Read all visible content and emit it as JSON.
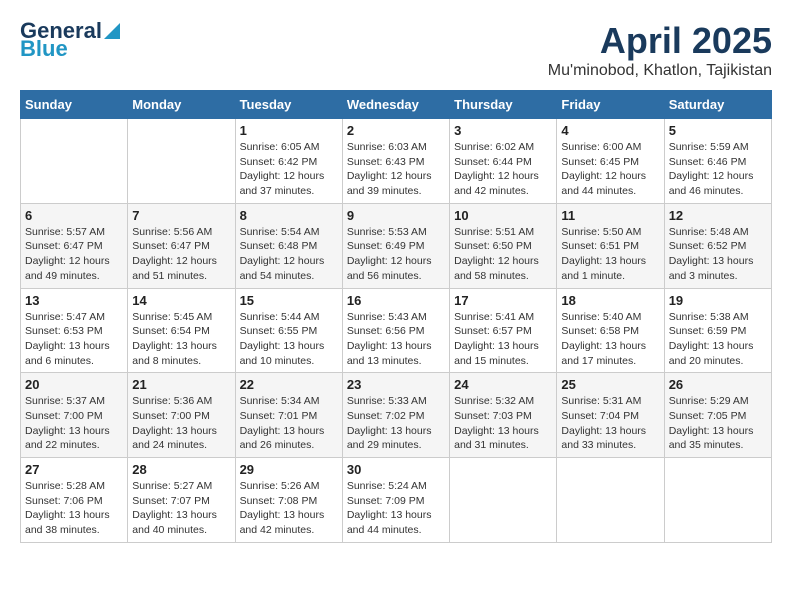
{
  "logo": {
    "line1": "General",
    "line2": "Blue"
  },
  "title": "April 2025",
  "subtitle": "Mu'minobod, Khatlon, Tajikistan",
  "days_of_week": [
    "Sunday",
    "Monday",
    "Tuesday",
    "Wednesday",
    "Thursday",
    "Friday",
    "Saturday"
  ],
  "weeks": [
    [
      {
        "day": "",
        "detail": ""
      },
      {
        "day": "",
        "detail": ""
      },
      {
        "day": "1",
        "detail": "Sunrise: 6:05 AM\nSunset: 6:42 PM\nDaylight: 12 hours and 37 minutes."
      },
      {
        "day": "2",
        "detail": "Sunrise: 6:03 AM\nSunset: 6:43 PM\nDaylight: 12 hours and 39 minutes."
      },
      {
        "day": "3",
        "detail": "Sunrise: 6:02 AM\nSunset: 6:44 PM\nDaylight: 12 hours and 42 minutes."
      },
      {
        "day": "4",
        "detail": "Sunrise: 6:00 AM\nSunset: 6:45 PM\nDaylight: 12 hours and 44 minutes."
      },
      {
        "day": "5",
        "detail": "Sunrise: 5:59 AM\nSunset: 6:46 PM\nDaylight: 12 hours and 46 minutes."
      }
    ],
    [
      {
        "day": "6",
        "detail": "Sunrise: 5:57 AM\nSunset: 6:47 PM\nDaylight: 12 hours and 49 minutes."
      },
      {
        "day": "7",
        "detail": "Sunrise: 5:56 AM\nSunset: 6:47 PM\nDaylight: 12 hours and 51 minutes."
      },
      {
        "day": "8",
        "detail": "Sunrise: 5:54 AM\nSunset: 6:48 PM\nDaylight: 12 hours and 54 minutes."
      },
      {
        "day": "9",
        "detail": "Sunrise: 5:53 AM\nSunset: 6:49 PM\nDaylight: 12 hours and 56 minutes."
      },
      {
        "day": "10",
        "detail": "Sunrise: 5:51 AM\nSunset: 6:50 PM\nDaylight: 12 hours and 58 minutes."
      },
      {
        "day": "11",
        "detail": "Sunrise: 5:50 AM\nSunset: 6:51 PM\nDaylight: 13 hours and 1 minute."
      },
      {
        "day": "12",
        "detail": "Sunrise: 5:48 AM\nSunset: 6:52 PM\nDaylight: 13 hours and 3 minutes."
      }
    ],
    [
      {
        "day": "13",
        "detail": "Sunrise: 5:47 AM\nSunset: 6:53 PM\nDaylight: 13 hours and 6 minutes."
      },
      {
        "day": "14",
        "detail": "Sunrise: 5:45 AM\nSunset: 6:54 PM\nDaylight: 13 hours and 8 minutes."
      },
      {
        "day": "15",
        "detail": "Sunrise: 5:44 AM\nSunset: 6:55 PM\nDaylight: 13 hours and 10 minutes."
      },
      {
        "day": "16",
        "detail": "Sunrise: 5:43 AM\nSunset: 6:56 PM\nDaylight: 13 hours and 13 minutes."
      },
      {
        "day": "17",
        "detail": "Sunrise: 5:41 AM\nSunset: 6:57 PM\nDaylight: 13 hours and 15 minutes."
      },
      {
        "day": "18",
        "detail": "Sunrise: 5:40 AM\nSunset: 6:58 PM\nDaylight: 13 hours and 17 minutes."
      },
      {
        "day": "19",
        "detail": "Sunrise: 5:38 AM\nSunset: 6:59 PM\nDaylight: 13 hours and 20 minutes."
      }
    ],
    [
      {
        "day": "20",
        "detail": "Sunrise: 5:37 AM\nSunset: 7:00 PM\nDaylight: 13 hours and 22 minutes."
      },
      {
        "day": "21",
        "detail": "Sunrise: 5:36 AM\nSunset: 7:00 PM\nDaylight: 13 hours and 24 minutes."
      },
      {
        "day": "22",
        "detail": "Sunrise: 5:34 AM\nSunset: 7:01 PM\nDaylight: 13 hours and 26 minutes."
      },
      {
        "day": "23",
        "detail": "Sunrise: 5:33 AM\nSunset: 7:02 PM\nDaylight: 13 hours and 29 minutes."
      },
      {
        "day": "24",
        "detail": "Sunrise: 5:32 AM\nSunset: 7:03 PM\nDaylight: 13 hours and 31 minutes."
      },
      {
        "day": "25",
        "detail": "Sunrise: 5:31 AM\nSunset: 7:04 PM\nDaylight: 13 hours and 33 minutes."
      },
      {
        "day": "26",
        "detail": "Sunrise: 5:29 AM\nSunset: 7:05 PM\nDaylight: 13 hours and 35 minutes."
      }
    ],
    [
      {
        "day": "27",
        "detail": "Sunrise: 5:28 AM\nSunset: 7:06 PM\nDaylight: 13 hours and 38 minutes."
      },
      {
        "day": "28",
        "detail": "Sunrise: 5:27 AM\nSunset: 7:07 PM\nDaylight: 13 hours and 40 minutes."
      },
      {
        "day": "29",
        "detail": "Sunrise: 5:26 AM\nSunset: 7:08 PM\nDaylight: 13 hours and 42 minutes."
      },
      {
        "day": "30",
        "detail": "Sunrise: 5:24 AM\nSunset: 7:09 PM\nDaylight: 13 hours and 44 minutes."
      },
      {
        "day": "",
        "detail": ""
      },
      {
        "day": "",
        "detail": ""
      },
      {
        "day": "",
        "detail": ""
      }
    ]
  ]
}
